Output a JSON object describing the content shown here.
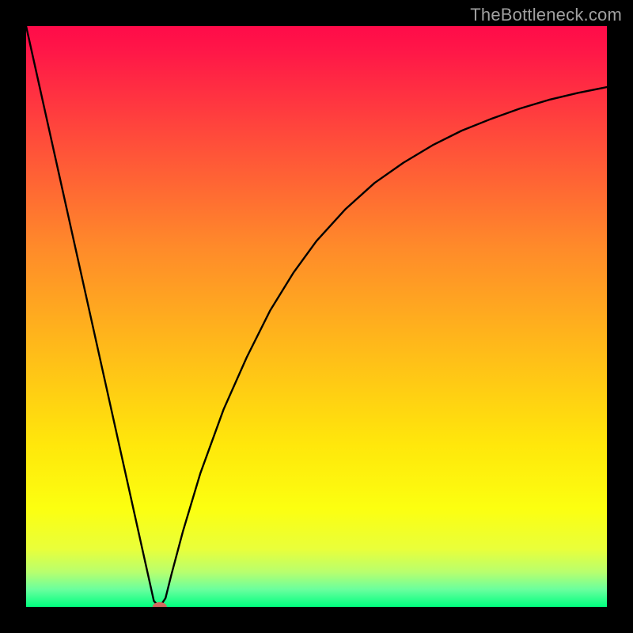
{
  "watermark": "TheBottleneck.com",
  "chart_data": {
    "type": "line",
    "title": "",
    "xlabel": "",
    "ylabel": "",
    "xlim": [
      0,
      100
    ],
    "ylim": [
      0,
      100
    ],
    "x": [
      0,
      2,
      4,
      6,
      8,
      10,
      12,
      14,
      16,
      18,
      20,
      21,
      22,
      23,
      24,
      25,
      27,
      30,
      34,
      38,
      42,
      46,
      50,
      55,
      60,
      65,
      70,
      75,
      80,
      85,
      90,
      95,
      100
    ],
    "values": [
      100,
      91,
      82,
      73,
      64,
      55,
      46,
      37,
      28,
      19,
      10,
      5.5,
      1,
      0,
      1.5,
      5.5,
      13,
      23,
      34,
      43,
      51,
      57.5,
      63,
      68.5,
      73,
      76.5,
      79.5,
      82,
      84,
      85.8,
      87.3,
      88.5,
      89.5
    ],
    "marker": {
      "x": 23,
      "y": 0,
      "color": "#d1695f",
      "shape": "ellipse"
    },
    "gradient_stops": [
      {
        "pos": 0.0,
        "color": "#ff0b49"
      },
      {
        "pos": 0.2,
        "color": "#ff4e3a"
      },
      {
        "pos": 0.38,
        "color": "#ff8a2a"
      },
      {
        "pos": 0.55,
        "color": "#ffb91a"
      },
      {
        "pos": 0.72,
        "color": "#ffe70b"
      },
      {
        "pos": 0.83,
        "color": "#fcff10"
      },
      {
        "pos": 0.9,
        "color": "#e9ff3a"
      },
      {
        "pos": 0.97,
        "color": "#6aff9e"
      },
      {
        "pos": 1.0,
        "color": "#00ff7f"
      }
    ]
  }
}
